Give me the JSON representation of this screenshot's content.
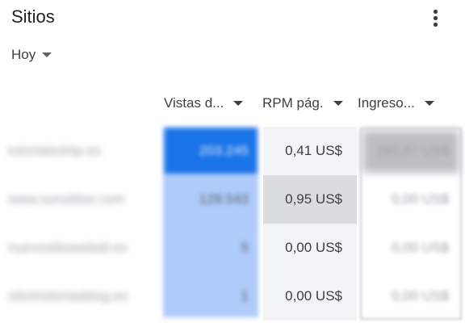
{
  "header": {
    "title": "Sitios",
    "more_icon": "more-vert-icon"
  },
  "date_range": {
    "label": "Hoy"
  },
  "columns": [
    {
      "label": "Vistas d..."
    },
    {
      "label": "RPM pág."
    },
    {
      "label": "Ingreso..."
    }
  ],
  "rows": [
    {
      "site": "tutorialeshtp.es",
      "views": "203.245",
      "rpm": "0,41 US$",
      "income": "290,87 US$"
    },
    {
      "site": "www.sunsitioe.com",
      "views": "128.543",
      "rpm": "0,95 US$",
      "income": "0,00 US$"
    },
    {
      "site": "nuevositiowebalt.es",
      "views": "5",
      "rpm": "0,00 US$",
      "income": "0,00 US$"
    },
    {
      "site": "sitiohistoriasblog.es",
      "views": "1",
      "rpm": "0,00 US$",
      "income": "0,00 US$"
    }
  ],
  "colors": {
    "accent": "#1a73e8",
    "bar_light": "#aecbfa",
    "selected_cell": "#dadce0"
  }
}
